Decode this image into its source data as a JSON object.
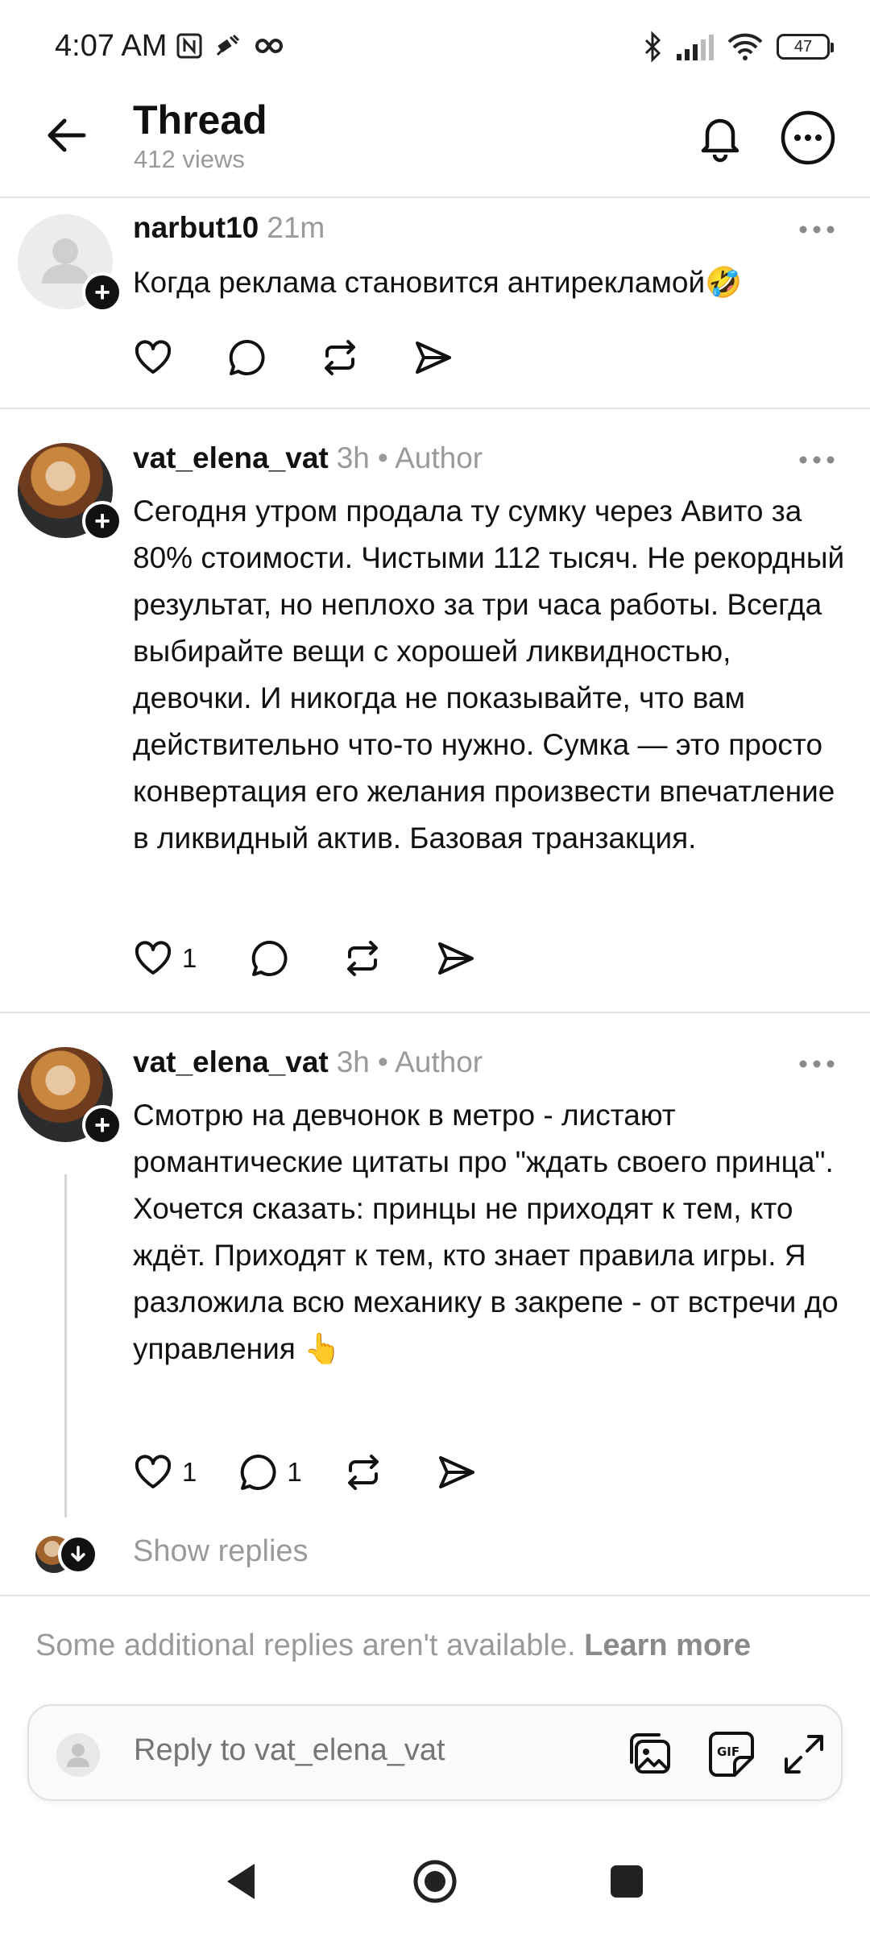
{
  "status_bar": {
    "time": "4:07 AM",
    "battery": "47"
  },
  "header": {
    "title": "Thread",
    "views": "412 views"
  },
  "posts": [
    {
      "username": "narbut10",
      "time": "21m",
      "author_tag": "",
      "text": "Когда реклама становится антирекламой🤣",
      "likes": "",
      "replies": ""
    },
    {
      "username": "vat_elena_vat",
      "time": "3h",
      "author_tag": "• Author",
      "text": "Сегодня утром продала ту сумку через Авито за 80% стоимости. Чистыми 112 тысяч. Не рекордный результат, но неплохо за три часа работы. Всегда выбирайте вещи с хорошей ликвидностью, девочки. И никогда не показывайте, что вам действительно что-то нужно. Сумка — это просто конвертация его желания произвести впечатление в ликвидный актив. Базовая транзакция.",
      "likes": "1",
      "replies": ""
    },
    {
      "username": "vat_elena_vat",
      "time": "3h",
      "author_tag": "• Author",
      "text": "Смотрю на девчонок в метро - листают романтические цитаты про \"ждать своего принца\". Хочется сказать: принцы не приходят к тем, кто ждёт. Приходят к тем, кто знает правила игры. Я разложила всю механику в закрепе - от встречи до управления 👆",
      "likes": "1",
      "replies": "1"
    }
  ],
  "show_replies": "Show replies",
  "notice": {
    "text": "Some additional replies aren't available.",
    "link": "Learn more"
  },
  "composer": {
    "placeholder": "Reply to vat_elena_vat"
  },
  "icons": {
    "back": "arrow-left-icon",
    "bell": "bell-icon",
    "more": "more-circle-icon",
    "like": "heart-icon",
    "reply": "comment-icon",
    "repost": "repost-icon",
    "share": "send-icon",
    "image": "image-icon",
    "gif": "gif-icon",
    "expand": "expand-icon"
  }
}
